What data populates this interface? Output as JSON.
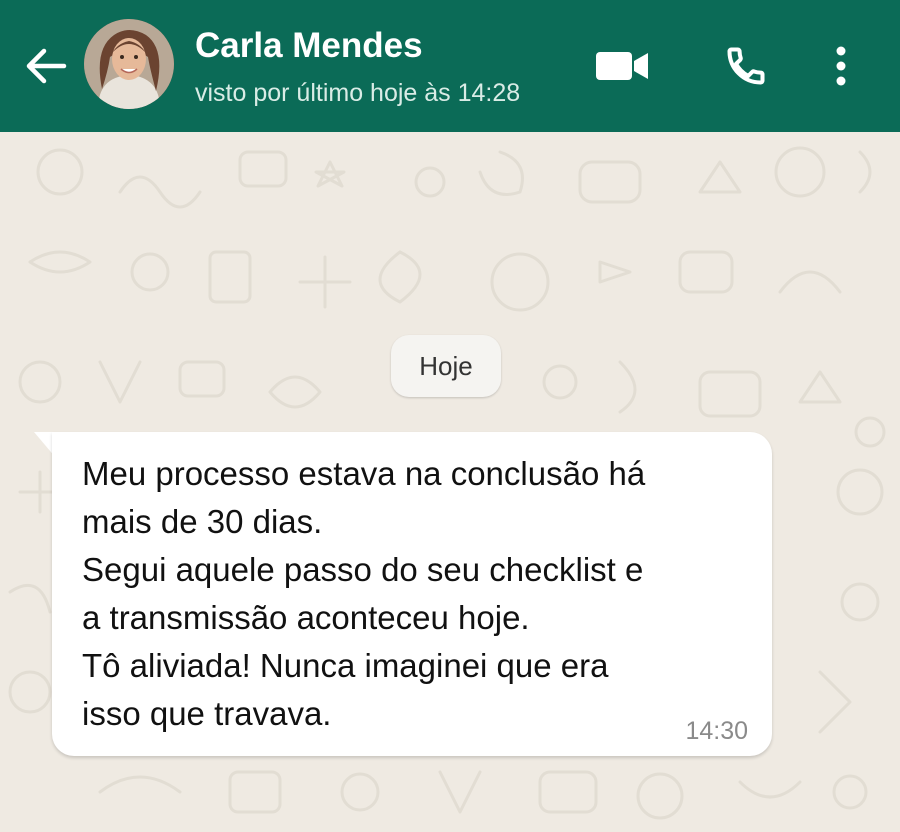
{
  "header": {
    "contact_name": "Carla Mendes",
    "status": "visto por último hoje às 14:28",
    "icons": [
      "back-arrow-icon",
      "video-camera-icon",
      "phone-icon",
      "more-vertical-icon"
    ],
    "background_color": "#0b6b57"
  },
  "chat": {
    "wallpaper_color": "#efeae2",
    "date_chip": "Hoje",
    "messages": [
      {
        "lines": [
          "Meu processo estava na conclusão há",
          "mais de 30 dias.",
          "Segui aquele passo do seu checklist e",
          "a transmissão aconteceu hoje.",
          "Tô aliviada! Nunca imaginei que era",
          "isso que travava."
        ],
        "time": "14:30",
        "direction": "incoming"
      }
    ]
  }
}
